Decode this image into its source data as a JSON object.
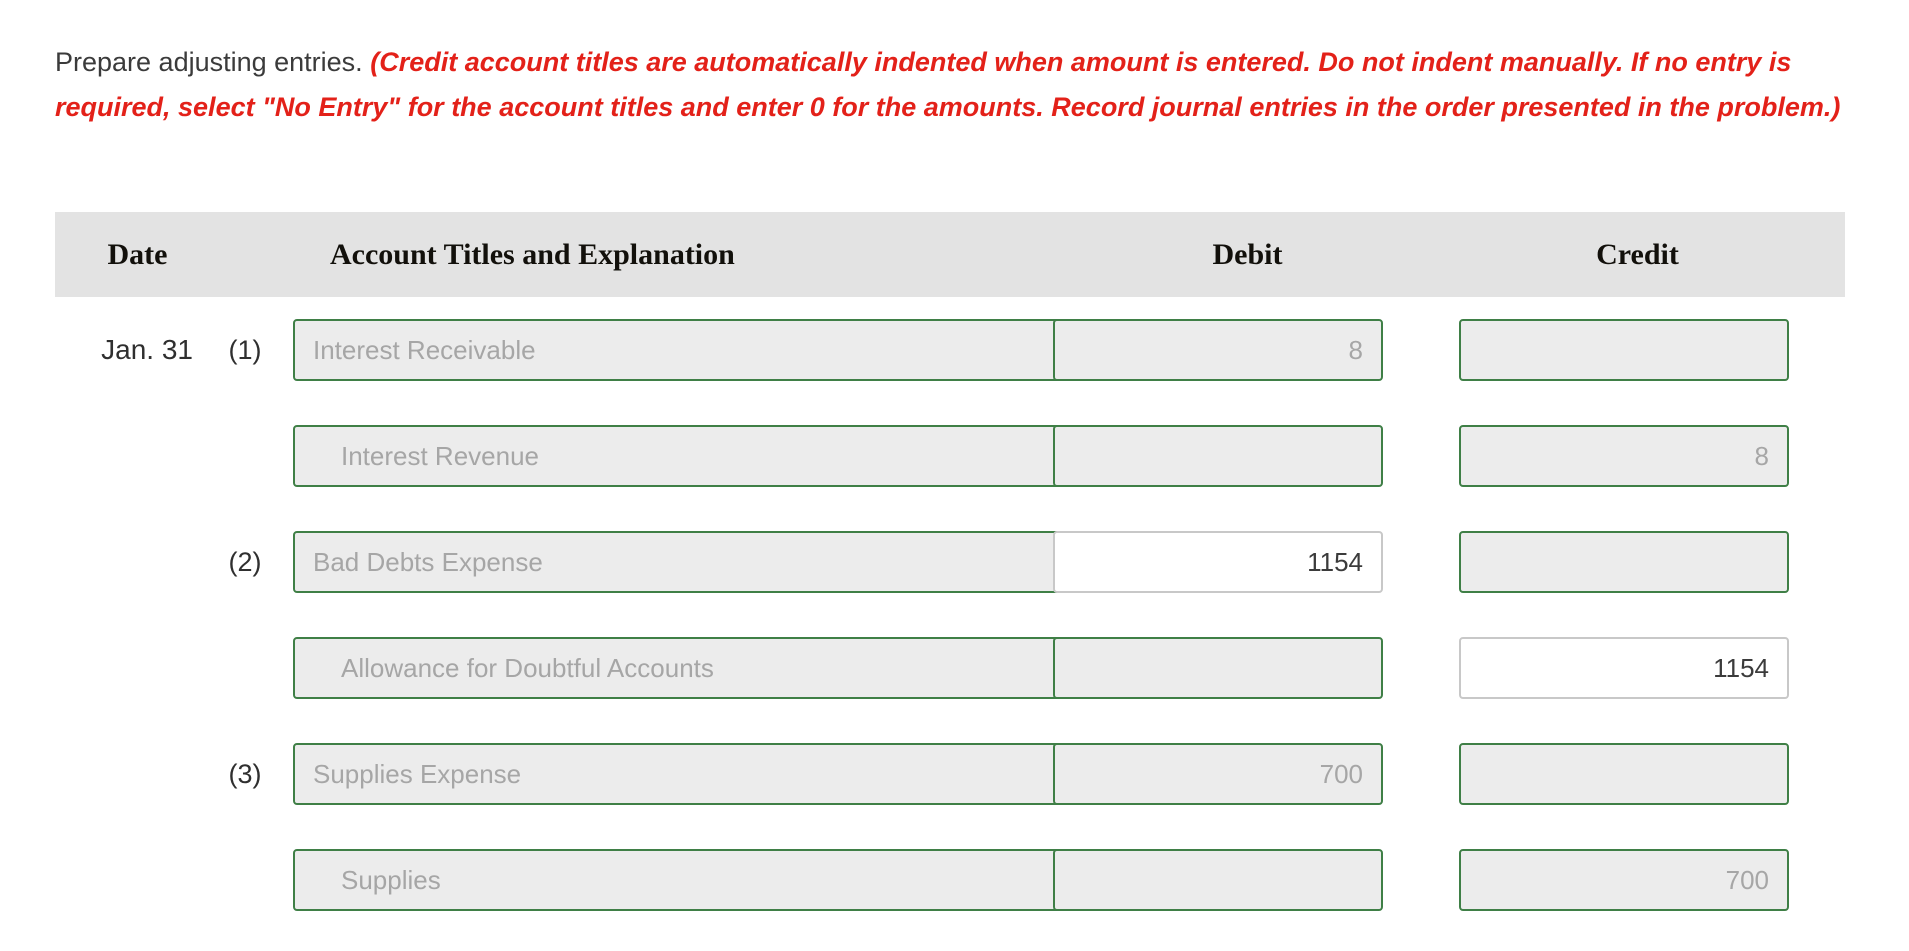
{
  "instructions": {
    "main": "Prepare adjusting entries.",
    "note": "(Credit account titles are automatically indented when amount is entered. Do not indent manually. If no entry is required, select \"No Entry\" for the account titles and enter 0 for the amounts. Record journal entries in the order presented in the problem.)",
    "note_color": "#e32119"
  },
  "table": {
    "headers": {
      "date": "Date",
      "account": "Account Titles and Explanation",
      "debit": "Debit",
      "credit": "Credit"
    },
    "header_bg": "#e3e3e3",
    "rows": [
      {
        "date": "Jan. 31",
        "entry_no": "(1)",
        "account": "Interest Receivable",
        "account_state": "ghost",
        "account_indent": false,
        "debit": "8",
        "debit_state": "ghost",
        "credit": "",
        "credit_state": "ghost"
      },
      {
        "date": "",
        "entry_no": "",
        "account": "Interest Revenue",
        "account_state": "ghost",
        "account_indent": true,
        "debit": "",
        "debit_state": "ghost",
        "credit": "8",
        "credit_state": "ghost"
      },
      {
        "date": "",
        "entry_no": "(2)",
        "account": "Bad Debts Expense",
        "account_state": "ghost",
        "account_indent": false,
        "debit": "1154",
        "debit_state": "filled",
        "credit": "",
        "credit_state": "ghost"
      },
      {
        "date": "",
        "entry_no": "",
        "account": "Allowance for Doubtful Accounts",
        "account_state": "ghost",
        "account_indent": true,
        "debit": "",
        "debit_state": "ghost",
        "credit": "1154",
        "credit_state": "filled"
      },
      {
        "date": "",
        "entry_no": "(3)",
        "account": "Supplies Expense",
        "account_state": "ghost",
        "account_indent": false,
        "debit": "700",
        "debit_state": "ghost",
        "credit": "",
        "credit_state": "ghost"
      },
      {
        "date": "",
        "entry_no": "",
        "account": "Supplies",
        "account_state": "ghost",
        "account_indent": true,
        "debit": "",
        "debit_state": "ghost",
        "credit": "700",
        "credit_state": "ghost"
      }
    ]
  }
}
